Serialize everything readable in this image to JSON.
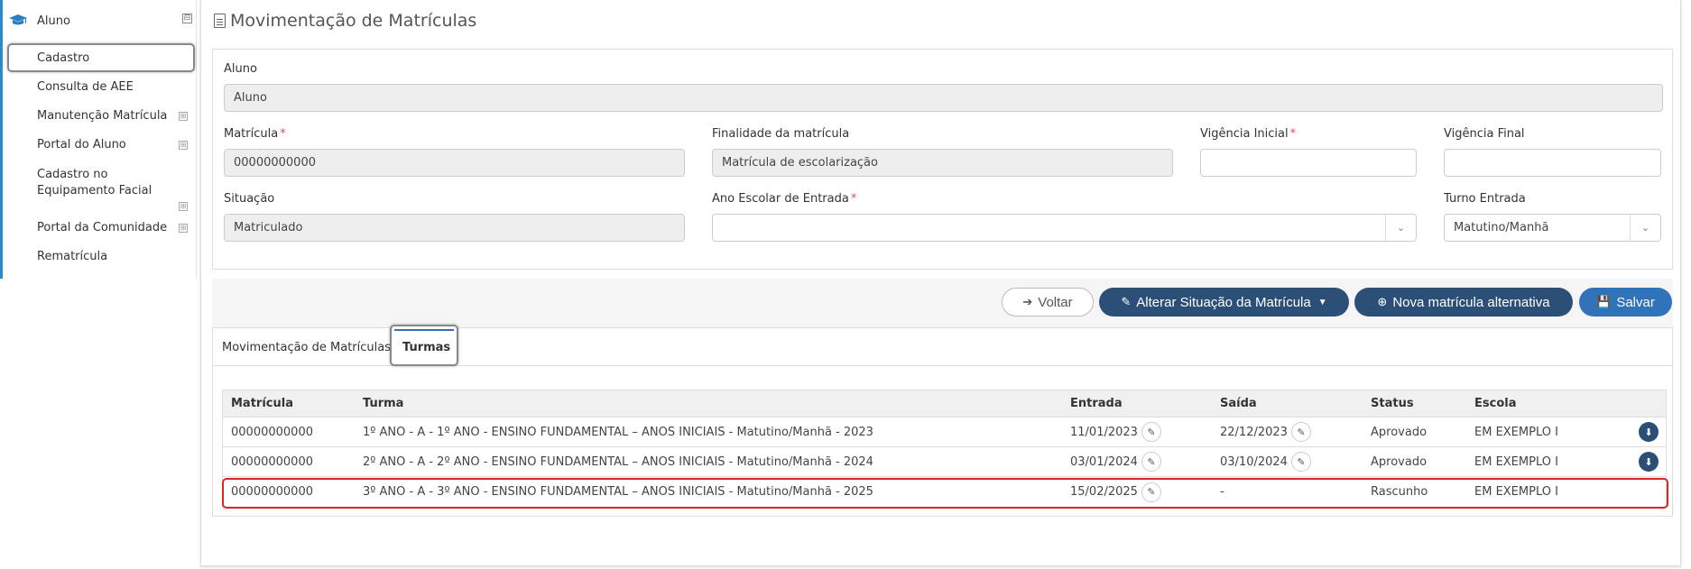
{
  "sidebar": {
    "header": "Aluno",
    "collapse_symbol": "⊟",
    "expand_symbol": "⊞",
    "items": [
      {
        "label": "Cadastro"
      },
      {
        "label": "Consulta de AEE"
      },
      {
        "label": "Manutenção Matrícula"
      },
      {
        "label": "Portal do Aluno"
      },
      {
        "label": "Cadastro no Equipamento Facial"
      },
      {
        "label": "Portal da Comunidade"
      },
      {
        "label": "Rematrícula"
      }
    ]
  },
  "page": {
    "title": "Movimentação de Matrículas"
  },
  "form": {
    "aluno_label": "Aluno",
    "aluno_value": "Aluno",
    "matricula_label": "Matrícula",
    "matricula_value": "00000000000",
    "finalidade_label": "Finalidade da matrícula",
    "finalidade_value": "Matrícula de escolarização",
    "vigencia_inicial_label": "Vigência Inicial",
    "vigencia_inicial_value": "",
    "vigencia_final_label": "Vigência Final",
    "vigencia_final_value": "",
    "situacao_label": "Situação",
    "situacao_value": "Matriculado",
    "ano_escolar_label": "Ano Escolar de Entrada",
    "ano_escolar_value": "",
    "turno_label": "Turno Entrada",
    "turno_value": "Matutino/Manhã",
    "required_mark": "*"
  },
  "actions": {
    "voltar": "Voltar",
    "alterar": "Alterar Situação da Matrícula",
    "nova": "Nova matrícula alternativa",
    "salvar": "Salvar"
  },
  "tabs": [
    {
      "label": "Movimentação de Matrículas"
    },
    {
      "label": "Turmas"
    }
  ],
  "table": {
    "headers": [
      "Matrícula",
      "Turma",
      "Entrada",
      "Saída",
      "Status",
      "Escola"
    ],
    "rows": [
      {
        "matricula": "00000000000",
        "turma": "1º ANO - A - 1º ANO - ENSINO FUNDAMENTAL – ANOS INICIAIS - Matutino/Manhã - 2023",
        "entrada": "11/01/2023",
        "saida": "22/12/2023",
        "status": "Aprovado",
        "escola": "EM EXEMPLO I"
      },
      {
        "matricula": "00000000000",
        "turma": "2º ANO - A - 2º ANO - ENSINO FUNDAMENTAL – ANOS INICIAIS - Matutino/Manhã - 2024",
        "entrada": "03/01/2024",
        "saida": "03/10/2024",
        "status": "Aprovado",
        "escola": "EM EXEMPLO I"
      },
      {
        "matricula": "00000000000",
        "turma": "3º ANO - A - 3º ANO - ENSINO FUNDAMENTAL – ANOS INICIAIS - Matutino/Manhã - 2025",
        "entrada": "15/02/2025",
        "saida": "-",
        "status": "Rascunho",
        "escola": "EM EXEMPLO I"
      }
    ]
  },
  "colors": {
    "accent": "#2a8bc8",
    "dark_button": "#2c4f78",
    "primary_button": "#3173b8",
    "highlight": "#d9252a"
  }
}
